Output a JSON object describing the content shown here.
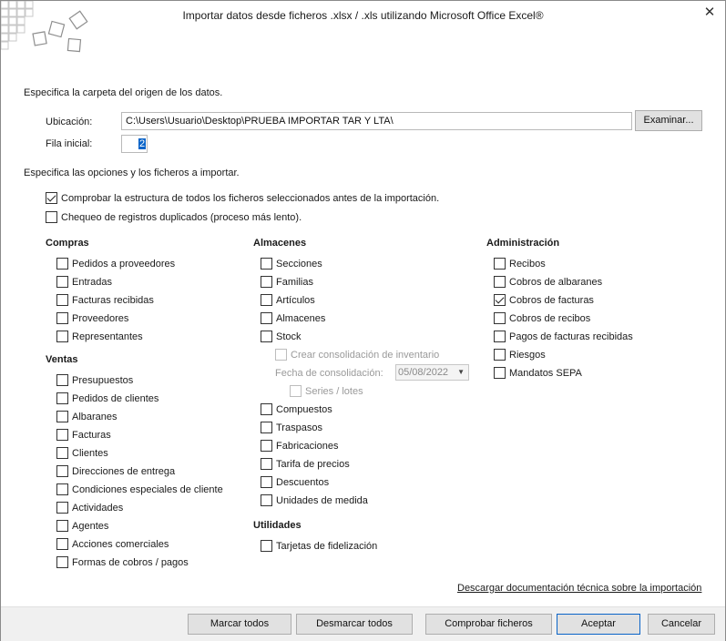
{
  "window": {
    "title": "Importar datos desde ficheros .xlsx / .xls utilizando Microsoft Office Excel®",
    "close_icon": "close-icon"
  },
  "source": {
    "heading": "Especifica la carpeta del origen de los datos.",
    "location_label": "Ubicación:",
    "location_value": "C:\\Users\\Usuario\\Desktop\\PRUEBA IMPORTAR TAR Y LTA\\",
    "browse_button": "Examinar...",
    "start_row_label": "Fila inicial:",
    "start_row_value": "2"
  },
  "options": {
    "heading": "Especifica las opciones y los ficheros a importar.",
    "check_structure": {
      "label": "Comprobar la estructura de todos los ficheros seleccionados antes de la importación.",
      "checked": true
    },
    "check_duplicates": {
      "label": "Chequeo de registros duplicados (proceso más lento).",
      "checked": false
    }
  },
  "compras": {
    "heading": "Compras",
    "items": [
      {
        "label": "Pedidos a proveedores",
        "checked": false
      },
      {
        "label": "Entradas",
        "checked": false
      },
      {
        "label": "Facturas recibidas",
        "checked": false
      },
      {
        "label": "Proveedores",
        "checked": false
      },
      {
        "label": "Representantes",
        "checked": false
      }
    ]
  },
  "ventas": {
    "heading": "Ventas",
    "items": [
      {
        "label": "Presupuestos",
        "checked": false
      },
      {
        "label": "Pedidos de clientes",
        "checked": false
      },
      {
        "label": "Albaranes",
        "checked": false
      },
      {
        "label": "Facturas",
        "checked": false
      },
      {
        "label": "Clientes",
        "checked": false
      },
      {
        "label": "Direcciones de entrega",
        "checked": false
      },
      {
        "label": "Condiciones especiales de cliente",
        "checked": false
      },
      {
        "label": "Actividades",
        "checked": false
      },
      {
        "label": "Agentes",
        "checked": false
      },
      {
        "label": "Acciones comerciales",
        "checked": false
      },
      {
        "label": "Formas de cobros / pagos",
        "checked": false
      }
    ]
  },
  "almacenes": {
    "heading": "Almacenes",
    "items": [
      {
        "label": "Secciones",
        "checked": false
      },
      {
        "label": "Familias",
        "checked": false
      },
      {
        "label": "Artículos",
        "checked": false
      },
      {
        "label": "Almacenes",
        "checked": false
      },
      {
        "label": "Stock",
        "checked": false
      }
    ],
    "stock_consolidation": {
      "label": "Crear consolidación de inventario",
      "checked": false
    },
    "consolidation_date_label": "Fecha de consolidación:",
    "consolidation_date_value": "05/08/2022",
    "series_lotes": {
      "label": "Series / lotes",
      "checked": false
    },
    "items2": [
      {
        "label": "Compuestos",
        "checked": false
      },
      {
        "label": "Traspasos",
        "checked": false
      },
      {
        "label": "Fabricaciones",
        "checked": false
      },
      {
        "label": "Tarifa de precios",
        "checked": false
      },
      {
        "label": "Descuentos",
        "checked": false
      },
      {
        "label": "Unidades de medida",
        "checked": false
      }
    ]
  },
  "utilidades": {
    "heading": "Utilidades",
    "items": [
      {
        "label": "Tarjetas de fidelización",
        "checked": false
      }
    ]
  },
  "administracion": {
    "heading": "Administración",
    "items": [
      {
        "label": "Recibos",
        "checked": false
      },
      {
        "label": "Cobros de albaranes",
        "checked": false
      },
      {
        "label": "Cobros de facturas",
        "checked": true
      },
      {
        "label": "Cobros de recibos",
        "checked": false
      },
      {
        "label": "Pagos de facturas recibidas",
        "checked": false
      },
      {
        "label": "Riesgos",
        "checked": false
      },
      {
        "label": "Mandatos SEPA",
        "checked": false
      }
    ]
  },
  "download_link": "Descargar documentación técnica sobre la importación",
  "footer": {
    "select_all": "Marcar todos",
    "deselect_all": "Desmarcar todos",
    "check_files": "Comprobar ficheros",
    "accept": "Aceptar",
    "cancel": "Cancelar"
  }
}
